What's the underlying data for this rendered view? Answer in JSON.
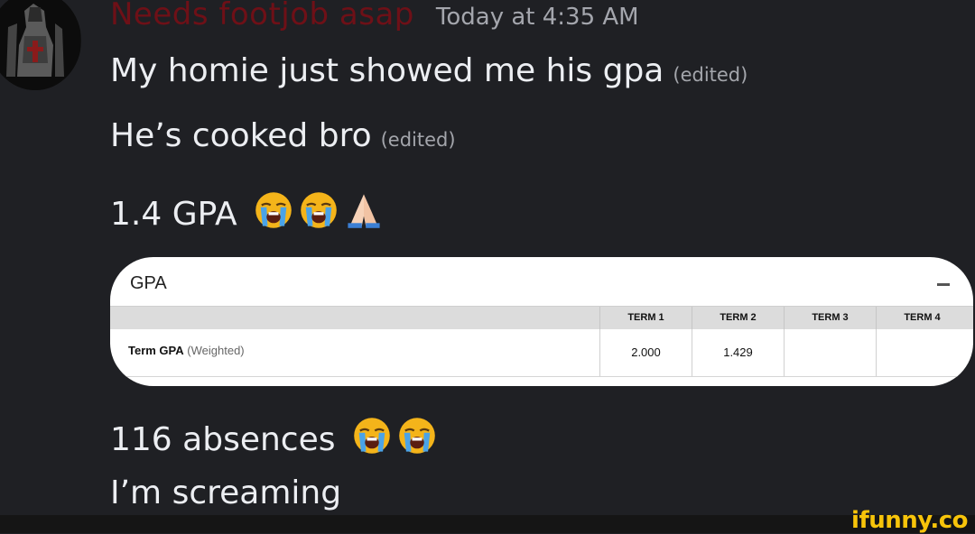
{
  "header": {
    "username": "Needs footjob asap",
    "timestamp": "Today at 4:35 AM"
  },
  "messages": [
    {
      "text": "My homie just showed me his gpa",
      "edited": "(edited)"
    },
    {
      "text": "He’s  cooked bro",
      "edited": "(edited)"
    },
    {
      "text": "1.4 GPA",
      "emojis": [
        "loudly-crying-face",
        "loudly-crying-face",
        "folded-hands"
      ]
    },
    {
      "text": "116 absences",
      "emojis": [
        "loudly-crying-face",
        "loudly-crying-face"
      ]
    },
    {
      "text": "I’m screaming"
    }
  ],
  "gpa_card": {
    "title": "GPA",
    "columns": [
      "TERM 1",
      "TERM 2",
      "TERM 3",
      "TERM 4"
    ],
    "row_label": "Term GPA",
    "row_sublabel": "(Weighted)",
    "values": [
      "2.000",
      "1.429",
      "",
      ""
    ]
  },
  "watermark": "ifunny.co",
  "colors": {
    "background": "#1f2024",
    "username": "#6e1017",
    "timestamp": "#a4a6ad",
    "watermark": "#f7c40a"
  }
}
